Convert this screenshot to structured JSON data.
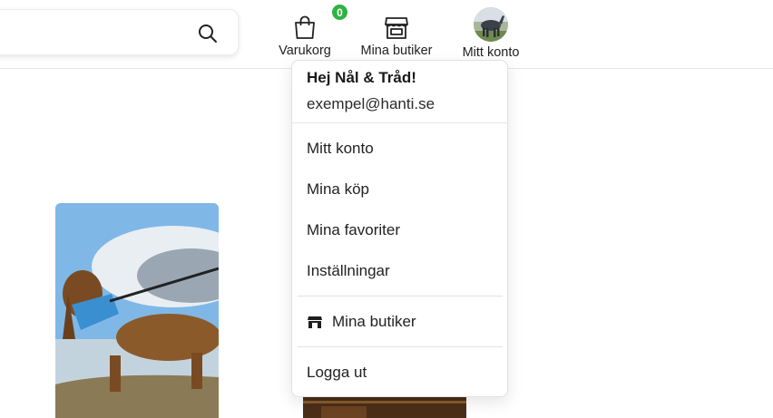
{
  "search": {
    "value": "",
    "placeholder": ""
  },
  "nav": {
    "cart": {
      "label": "Varukorg",
      "count": "0",
      "icon": "shopping-bag-icon"
    },
    "shops": {
      "label": "Mina butiker",
      "icon": "storefront-icon"
    },
    "account": {
      "label": "Mitt konto",
      "icon": "avatar"
    }
  },
  "dropdown": {
    "greeting": "Hej Nål & Tråd!",
    "email": "exempel@hanti.se",
    "items": [
      {
        "label": "Mitt konto"
      },
      {
        "label": "Mina köp"
      },
      {
        "label": "Mina favoriter"
      },
      {
        "label": "Inställningar"
      }
    ],
    "shops_label": "Mina butiker",
    "logout_label": "Logga ut"
  },
  "colors": {
    "badge": "#2fb344",
    "border": "#e6e6e6",
    "text": "#222222"
  }
}
